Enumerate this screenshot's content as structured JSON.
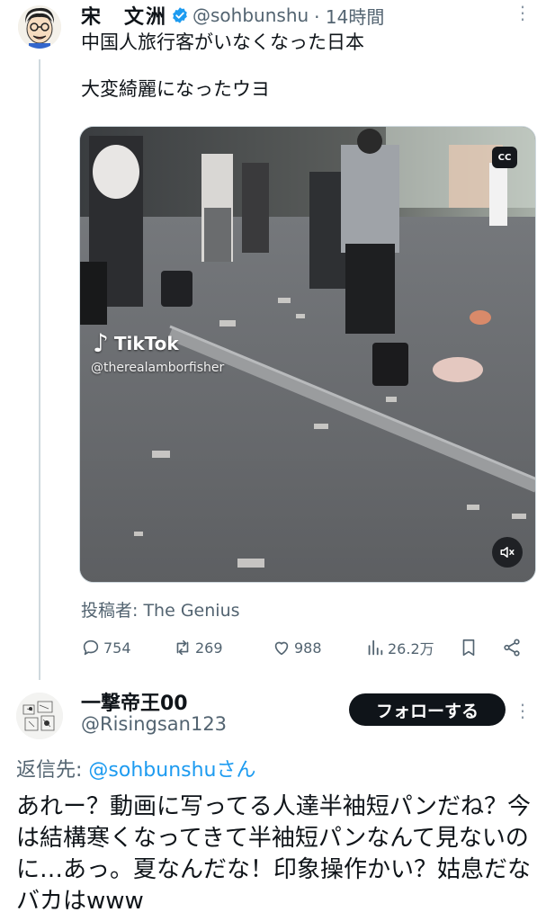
{
  "tweet": {
    "author_name": "宋　文洲",
    "author_handle": "@sohbunshu",
    "time": "· 14時間",
    "text": "中国人旅行客がいなくなった日本\n\n大変綺麗になったウヨ",
    "media": {
      "watermark": "TikTok",
      "watermark_user": "@therealamborfisher",
      "cc_label": "CC"
    },
    "attribution_label": "投稿者:",
    "attribution_value": "The Genius",
    "stats": {
      "replies": "754",
      "retweets": "269",
      "likes": "988",
      "views": "26.2万"
    }
  },
  "reply": {
    "author_name": "一撃帝王00",
    "author_handle": "@Risingsan123",
    "follow_label": "フォローする",
    "reply_to_label": "返信先:",
    "reply_to_mention": "@sohbunshuさん",
    "text": "あれー？動画に写ってる人達半袖短パンだね？今は結構寒くなってきて半袖短パンなんて見ないのに…あっ。夏なんだな！印象操作かい？姑息だなバカはwww"
  },
  "colors": {
    "accent": "#1d9bf0",
    "text": "#0f1419",
    "muted": "#536471"
  },
  "icons": [
    "verified-badge-icon",
    "more-icon",
    "reply-icon",
    "retweet-icon",
    "like-icon",
    "views-icon",
    "bookmark-icon",
    "share-icon",
    "mute-icon",
    "cc-icon",
    "tiktok-icon"
  ]
}
